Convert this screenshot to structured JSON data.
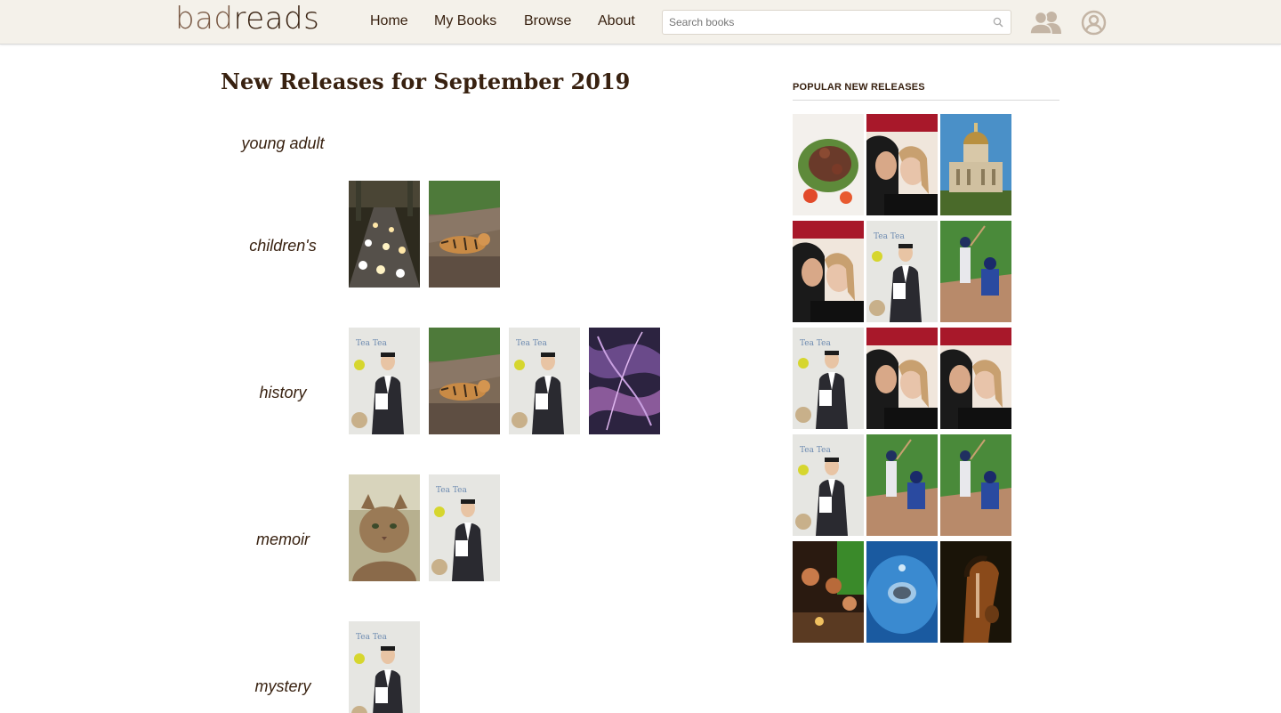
{
  "header": {
    "logo_part1": "bad",
    "logo_part2": "reads",
    "nav": [
      "Home",
      "My Books",
      "Browse",
      "About"
    ],
    "search_placeholder": "Search books",
    "icons": [
      "search-icon",
      "friends-icon",
      "profile-icon"
    ]
  },
  "page_title": "New Releases for September 2019",
  "genres": [
    {
      "name": "young adult",
      "covers": []
    },
    {
      "name": "children's",
      "covers": [
        "traffic-at-night",
        "tiger-on-wall"
      ]
    },
    {
      "name": "history",
      "covers": [
        "speaker-at-event",
        "tiger-on-wall",
        "speaker-at-event",
        "abstract-purple-smoke"
      ]
    },
    {
      "name": "memoir",
      "covers": [
        "cat-portrait",
        "speaker-at-event"
      ]
    },
    {
      "name": "mystery",
      "covers": [
        "speaker-at-event"
      ]
    }
  ],
  "sidebar": {
    "title": "POPULAR NEW RELEASES",
    "covers": [
      "salad-plate",
      "couple-portrait",
      "domed-building",
      "couple-portrait",
      "speaker-at-event",
      "baseball-game",
      "speaker-at-event",
      "couple-portrait",
      "couple-portrait",
      "speaker-at-event",
      "baseball-game",
      "baseball-game",
      "restaurant-crowd",
      "water-droplet",
      "horse-portrait"
    ]
  },
  "colors": {
    "brand_dark": "#382110",
    "brand_light": "#7a5a45",
    "header_bg": "#f4f1ea",
    "icon_tan": "#c4b5a5"
  }
}
